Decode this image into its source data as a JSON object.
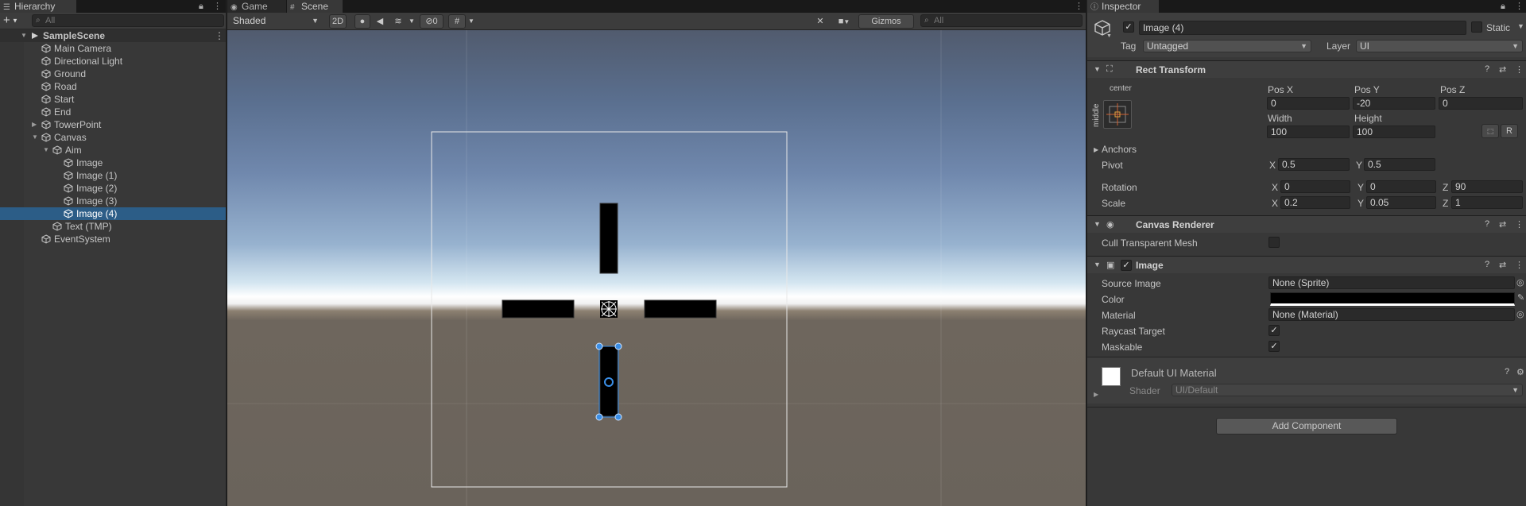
{
  "hierarchy": {
    "tab_label": "Hierarchy",
    "search_placeholder": "All",
    "add_label": "+",
    "items": [
      {
        "label": "SampleScene",
        "depth": 0,
        "arrow": "▼",
        "kind": "scene"
      },
      {
        "label": "Main Camera",
        "depth": 1,
        "arrow": ""
      },
      {
        "label": "Directional Light",
        "depth": 1,
        "arrow": ""
      },
      {
        "label": "Ground",
        "depth": 1,
        "arrow": ""
      },
      {
        "label": "Road",
        "depth": 1,
        "arrow": ""
      },
      {
        "label": "Start",
        "depth": 1,
        "arrow": ""
      },
      {
        "label": "End",
        "depth": 1,
        "arrow": ""
      },
      {
        "label": "TowerPoint",
        "depth": 1,
        "arrow": "▶"
      },
      {
        "label": "Canvas",
        "depth": 1,
        "arrow": "▼"
      },
      {
        "label": "Aim",
        "depth": 2,
        "arrow": "▼"
      },
      {
        "label": "Image",
        "depth": 3,
        "arrow": ""
      },
      {
        "label": "Image (1)",
        "depth": 3,
        "arrow": ""
      },
      {
        "label": "Image (2)",
        "depth": 3,
        "arrow": ""
      },
      {
        "label": "Image (3)",
        "depth": 3,
        "arrow": ""
      },
      {
        "label": "Image (4)",
        "depth": 3,
        "arrow": "",
        "selected": true
      },
      {
        "label": "Text (TMP)",
        "depth": 2,
        "arrow": ""
      },
      {
        "label": "EventSystem",
        "depth": 1,
        "arrow": ""
      }
    ]
  },
  "scene": {
    "tab_game": "Game",
    "tab_scene": "Scene",
    "shading_mode": "Shaded",
    "mode_2d": "2D",
    "hidden_count": "0",
    "gizmos_label": "Gizmos",
    "search_placeholder": "All"
  },
  "inspector": {
    "tab_label": "Inspector",
    "object_name": "Image (4)",
    "static_label": "Static",
    "tag_label": "Tag",
    "tag_value": "Untagged",
    "layer_label": "Layer",
    "layer_value": "UI",
    "rect_transform": {
      "title": "Rect Transform",
      "anchor_h": "center",
      "anchor_v": "middle",
      "pos_x_label": "Pos X",
      "pos_x": "0",
      "pos_y_label": "Pos Y",
      "pos_y": "-20",
      "pos_z_label": "Pos Z",
      "pos_z": "0",
      "width_label": "Width",
      "width": "100",
      "height_label": "Height",
      "height": "100",
      "r_label": "R",
      "anchors_label": "Anchors",
      "pivot_label": "Pivot",
      "pivot_x": "0.5",
      "pivot_y": "0.5",
      "rotation_label": "Rotation",
      "rot_x": "0",
      "rot_y": "0",
      "rot_z": "90",
      "scale_label": "Scale",
      "scale_x": "0.2",
      "scale_y": "0.05",
      "scale_z": "1",
      "x": "X",
      "y": "Y",
      "z": "Z"
    },
    "canvas_renderer": {
      "title": "Canvas Renderer",
      "cull_label": "Cull Transparent Mesh"
    },
    "image": {
      "title": "Image",
      "source_label": "Source Image",
      "source_value": "None (Sprite)",
      "color_label": "Color",
      "color_value": "#000000",
      "material_label": "Material",
      "material_value": "None (Material)",
      "raycast_label": "Raycast Target",
      "maskable_label": "Maskable"
    },
    "material": {
      "name": "Default UI Material",
      "shader_label": "Shader",
      "shader_value": "UI/Default"
    },
    "add_component": "Add Component"
  },
  "colors": {
    "selection": "#2c5d87",
    "panel": "#383838",
    "gizmo_blue": "#3a8ee6"
  }
}
